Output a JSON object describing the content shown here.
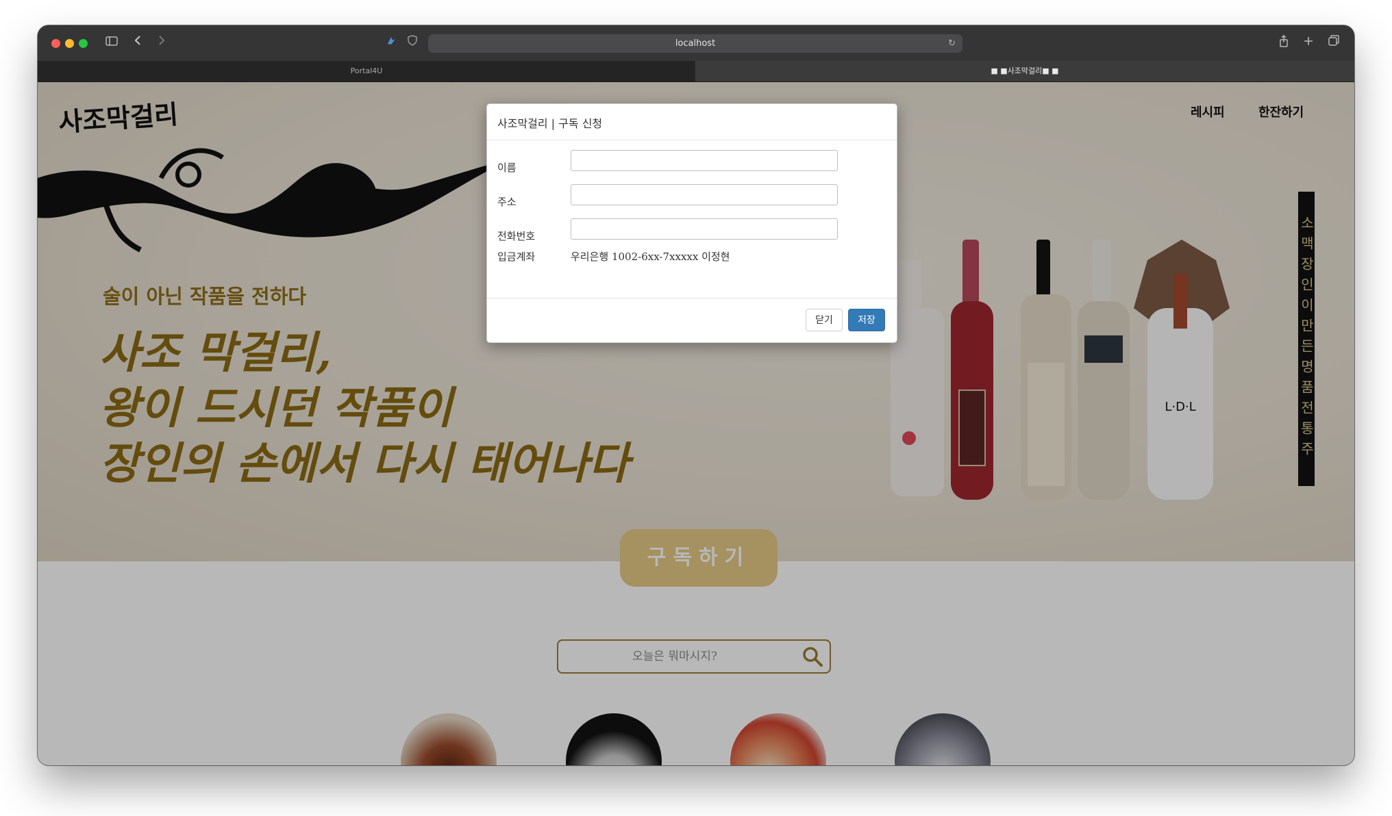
{
  "browser": {
    "url": "localhost",
    "tabs": [
      {
        "label": "Portal4U"
      },
      {
        "label": "■ ■사조막걸리■ ■"
      }
    ],
    "icons": [
      "sidebar-icon",
      "back-icon",
      "forward-icon",
      "extension-icon",
      "shield-icon",
      "reload-icon",
      "share-icon",
      "new-tab-icon",
      "tab-overview-icon"
    ]
  },
  "site": {
    "logo": "사조막걸리",
    "nav": {
      "recipe": "레시피",
      "drink": "한잔하기"
    },
    "tagline": "술이 아닌 작품을 전하다",
    "headline": {
      "line1": "사조 막걸리,",
      "line2": "왕이 드시던 작품이",
      "line3": "장인의 손에서 다시 태어나다"
    },
    "vertical_banner": "소맥장인이만든명품전통주",
    "subscribe_button": "구독하기",
    "search": {
      "placeholder": "오늘은 뭐마시지?"
    }
  },
  "modal": {
    "title": "사조막걸리 | 구독 신청",
    "fields": {
      "name_label": "이름",
      "address_label": "주소",
      "phone_label": "전화번호",
      "account_label": "입금계좌",
      "account_value": "우리은행 1002-6xx-7xxxxx 이정현"
    },
    "buttons": {
      "close": "닫기",
      "save": "저장"
    }
  },
  "colors": {
    "accent": "#8a6a12",
    "primary_button": "#337ab7",
    "subscribe_button": "#e7c986"
  }
}
